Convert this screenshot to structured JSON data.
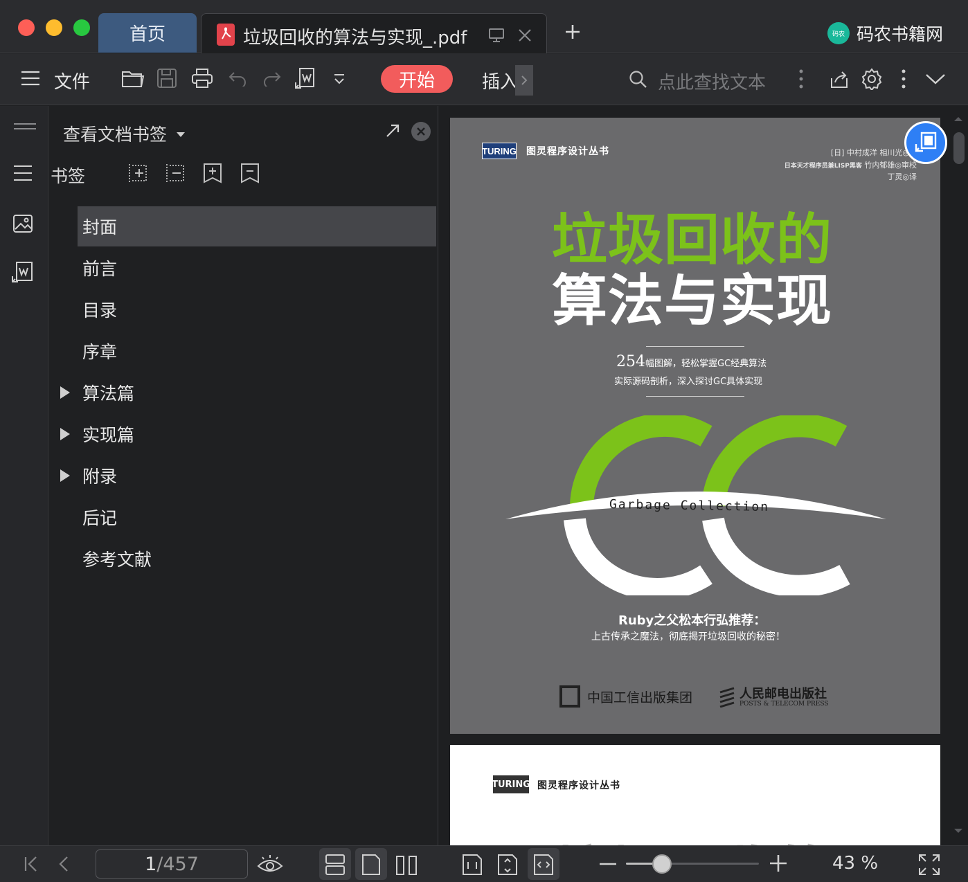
{
  "window": {
    "traffic_lights": {
      "close": "#fe5f57",
      "minimize": "#febc2e",
      "maximize": "#28c840"
    }
  },
  "tabs": {
    "home_label": "首页",
    "doc_title": "垃圾回收的算法与实现_.pdf",
    "new_tab_symbol": "+"
  },
  "brand": {
    "name": "码农书籍网",
    "logo_text": "码农"
  },
  "toolbar": {
    "menu_label": "文件",
    "start_label": "开始",
    "insert_label": "插入",
    "search_placeholder": "点此查找文本"
  },
  "panel": {
    "title": "查看文档书签",
    "bookmarks_label": "书签",
    "items": [
      {
        "label": "封面",
        "expandable": false,
        "selected": true
      },
      {
        "label": "前言",
        "expandable": false,
        "selected": false
      },
      {
        "label": "目录",
        "expandable": false,
        "selected": false
      },
      {
        "label": "序章",
        "expandable": false,
        "selected": false
      },
      {
        "label": "算法篇",
        "expandable": true,
        "selected": false
      },
      {
        "label": "实现篇",
        "expandable": true,
        "selected": false
      },
      {
        "label": "附录",
        "expandable": true,
        "selected": false
      },
      {
        "label": "后记",
        "expandable": false,
        "selected": false
      },
      {
        "label": "参考文献",
        "expandable": false,
        "selected": false
      }
    ]
  },
  "cover": {
    "publisher_logo": "TURING",
    "series": "图灵程序设计丛书",
    "authors_line1": "[日] 中村成洋  相川光◎著",
    "authors_line2_prefix": "日本天才程序员兼LISP黑客",
    "authors_line2": "竹内郁雄◎审校",
    "translator": "丁灵◎译",
    "title_line1": "垃圾回收的",
    "title_line2": "算法与实现",
    "tag_num": "254",
    "tag_line1": "幅图解，轻松掌握GC经典算法",
    "tag_line2": "实际源码剖析，深入探讨GC具体实现",
    "gc_letters": "GC",
    "gc_caption": "Garbage Collection",
    "recommend_title": "Ruby之父松本行弘推荐：",
    "recommend_text": "上古传承之魔法，彻底揭开垃圾回收的秘密！",
    "publisher1": "中国工信出版集团",
    "publisher2": "人民邮电出版社",
    "publisher2_en": "POSTS & TELECOM PRESS",
    "accent_green": "#7cc21a"
  },
  "page2": {
    "publisher_logo": "TURING",
    "series": "图灵程序设计丛书",
    "title_partial": "垃圾回收的"
  },
  "status": {
    "current_page": "1",
    "total_pages": "457",
    "zoom": "43 %",
    "zoom_fraction": 0.27
  }
}
